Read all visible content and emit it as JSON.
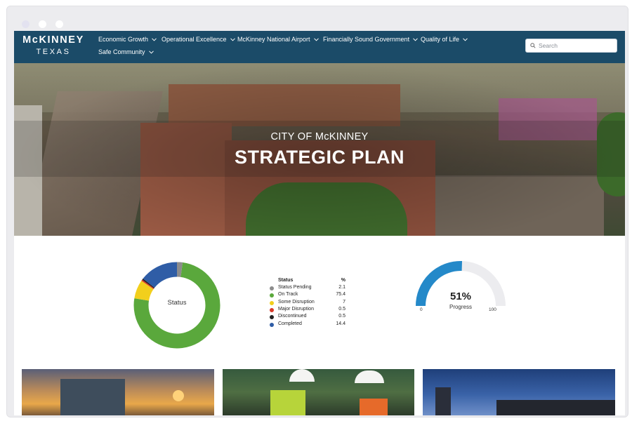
{
  "window": {
    "controls": [
      "window-dot-1",
      "window-dot-2",
      "window-dot-3"
    ]
  },
  "header": {
    "logo_line1": "McKINNEY",
    "logo_line2": "TEXAS",
    "nav": [
      {
        "label": "Economic Growth"
      },
      {
        "label": "Operational Excellence"
      },
      {
        "label": "McKinney National Airport"
      },
      {
        "label": "Financially Sound Government"
      },
      {
        "label": "Quality of Life"
      },
      {
        "label": "Safe Community"
      }
    ],
    "search": {
      "placeholder": "Search",
      "icon": "search-icon"
    },
    "colors": {
      "nav_bg": "#1b4b68"
    }
  },
  "hero": {
    "subtitle": "CITY OF McKINNEY",
    "title": "STRATEGIC PLAN"
  },
  "status_chart": {
    "center_label": "Status",
    "legend_header_label": "Status",
    "legend_header_value": "%"
  },
  "chart_data": [
    {
      "type": "pie",
      "title": "",
      "categories": [
        "Status Pending",
        "On Track",
        "Some Disruption",
        "Major Disruption",
        "Discontinued",
        "Completed"
      ],
      "values": [
        2.1,
        75.4,
        7,
        0.5,
        0.5,
        14.4
      ],
      "colors": [
        "#8c8c8c",
        "#5aa83c",
        "#f2cf1c",
        "#d83a2a",
        "#222222",
        "#2f5da6"
      ],
      "legend": "right"
    }
  ],
  "progress": {
    "value": 51,
    "label_pct": "51%",
    "label": "Progress",
    "min_label": "0",
    "max_label": "100",
    "colors": {
      "fill": "#2489c9",
      "track": "#ececef"
    }
  }
}
